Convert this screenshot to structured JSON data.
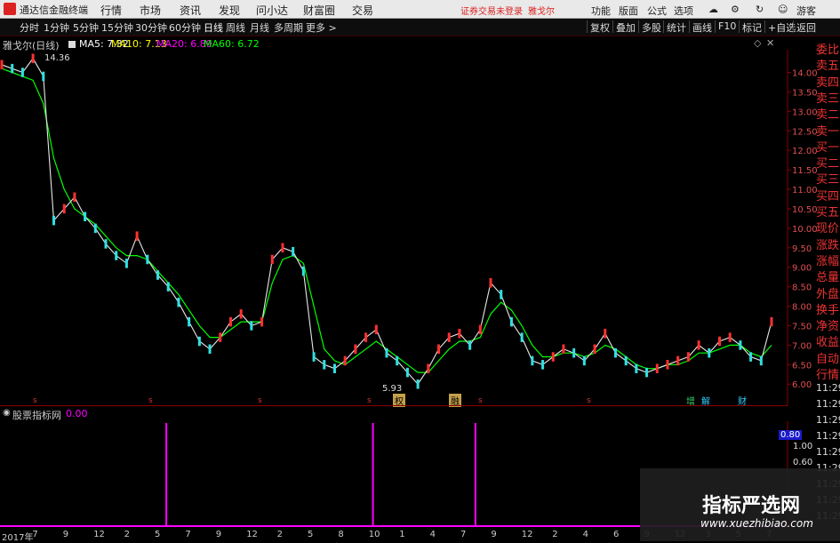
{
  "menubar": {
    "app_title": "通达信金融终端",
    "items": [
      "行情",
      "市场",
      "资讯",
      "发现",
      "问小达",
      "财富圈",
      "交易"
    ],
    "warning": "证券交易未登录",
    "stock": "雅戈尔",
    "right": [
      "功能",
      "版面",
      "公式",
      "选项",
      "游客"
    ]
  },
  "toolbar": {
    "periods": [
      "分时",
      "1分钟",
      "5分钟",
      "15分钟",
      "30分钟",
      "60分钟",
      "日线",
      "周线",
      "月线",
      "多周期",
      "更多 >"
    ],
    "active_period": "日线",
    "buttons": [
      "复权",
      "叠加",
      "多股",
      "统计",
      "画线",
      "F10",
      "标记",
      "+自选",
      "返回"
    ]
  },
  "chart_header": {
    "title": "雅戈尔(日线)",
    "ma5": "MA5: 7.32",
    "ma10": "MA10: 7.13",
    "ma20": "MA20: 6.89",
    "ma60": "MA60: 6.72",
    "colors": {
      "ma5": "#ffffff",
      "ma10": "#ffff00",
      "ma20": "#ff00ff",
      "ma60": "#00ff00"
    }
  },
  "annotations": {
    "high": "14.36",
    "low": "5.93"
  },
  "event_tags": [
    "权",
    "融",
    "增",
    "解",
    "财"
  ],
  "chart_data": {
    "type": "line",
    "title": "雅戈尔(日线)",
    "ylim": [
      5.8,
      14.4
    ],
    "y_ticks": [
      "14.00",
      "13.50",
      "13.00",
      "12.50",
      "12.00",
      "11.50",
      "11.00",
      "10.50",
      "10.00",
      "9.50",
      "9.00",
      "8.50",
      "8.00",
      "7.50",
      "7.00",
      "6.50",
      "6.00"
    ],
    "x_ticks": [
      "2017年",
      "7",
      "9",
      "12",
      "2",
      "5",
      "7",
      "9",
      "12",
      "2",
      "5",
      "8",
      "10",
      "1",
      "4",
      "7",
      "9",
      "12",
      "2",
      "4",
      "6",
      "9",
      "12",
      "3",
      "5",
      "7"
    ],
    "series": [
      {
        "name": "close",
        "values": [
          14.2,
          14.1,
          14.0,
          14.36,
          13.9,
          10.2,
          10.5,
          10.8,
          10.3,
          10.0,
          9.6,
          9.3,
          9.1,
          9.8,
          9.2,
          8.8,
          8.5,
          8.1,
          7.6,
          7.1,
          6.9,
          7.2,
          7.6,
          7.8,
          7.5,
          7.6,
          9.2,
          9.5,
          9.4,
          8.9,
          6.7,
          6.5,
          6.4,
          6.6,
          6.9,
          7.2,
          7.4,
          6.8,
          6.6,
          6.3,
          6.0,
          6.4,
          6.9,
          7.2,
          7.3,
          7.0,
          7.4,
          8.6,
          8.3,
          7.6,
          7.2,
          6.6,
          6.5,
          6.7,
          6.9,
          6.8,
          6.6,
          6.9,
          7.3,
          6.8,
          6.6,
          6.4,
          6.3,
          6.4,
          6.5,
          6.6,
          6.7,
          7.0,
          6.8,
          7.1,
          7.2,
          7.0,
          6.7,
          6.6,
          7.6
        ]
      },
      {
        "name": "MA",
        "values": [
          14.1,
          14.0,
          13.9,
          13.8,
          13.2,
          11.8,
          11.0,
          10.5,
          10.3,
          10.1,
          9.8,
          9.5,
          9.3,
          9.3,
          9.2,
          8.9,
          8.6,
          8.3,
          7.9,
          7.5,
          7.2,
          7.2,
          7.4,
          7.6,
          7.6,
          7.6,
          8.6,
          9.2,
          9.3,
          9.1,
          8.0,
          6.9,
          6.6,
          6.5,
          6.7,
          6.9,
          7.1,
          6.9,
          6.7,
          6.5,
          6.3,
          6.3,
          6.6,
          6.9,
          7.1,
          7.1,
          7.2,
          7.8,
          8.1,
          7.9,
          7.5,
          7.0,
          6.7,
          6.7,
          6.8,
          6.8,
          6.7,
          6.8,
          7.0,
          6.9,
          6.7,
          6.5,
          6.4,
          6.4,
          6.5,
          6.5,
          6.6,
          6.8,
          6.8,
          6.9,
          7.0,
          7.0,
          6.8,
          6.7,
          7.0
        ]
      }
    ]
  },
  "indicator": {
    "title": "股票指标网",
    "value": "0.00",
    "y_ticks": [
      "1.00",
      "0.80",
      "0.60"
    ],
    "current": "0.80",
    "spikes": [
      0.198,
      0.444,
      0.566
    ]
  },
  "right_panel": {
    "labels": [
      "委比",
      "卖五",
      "卖四",
      "卖三",
      "卖二",
      "卖一",
      "买一",
      "买二",
      "买三",
      "买四",
      "买五",
      "现价",
      "涨跌",
      "涨幅",
      "总量",
      "外盘",
      "换手",
      "净资",
      "收益",
      "自动",
      "行情"
    ],
    "times": [
      "11:29",
      "11:29",
      "11:29",
      "11:29",
      "11:29",
      "11:29",
      "11:29",
      "11:29",
      "11:29"
    ]
  },
  "watermark": {
    "title": "指标严选网",
    "url": "www.xuezhibiao.com"
  }
}
